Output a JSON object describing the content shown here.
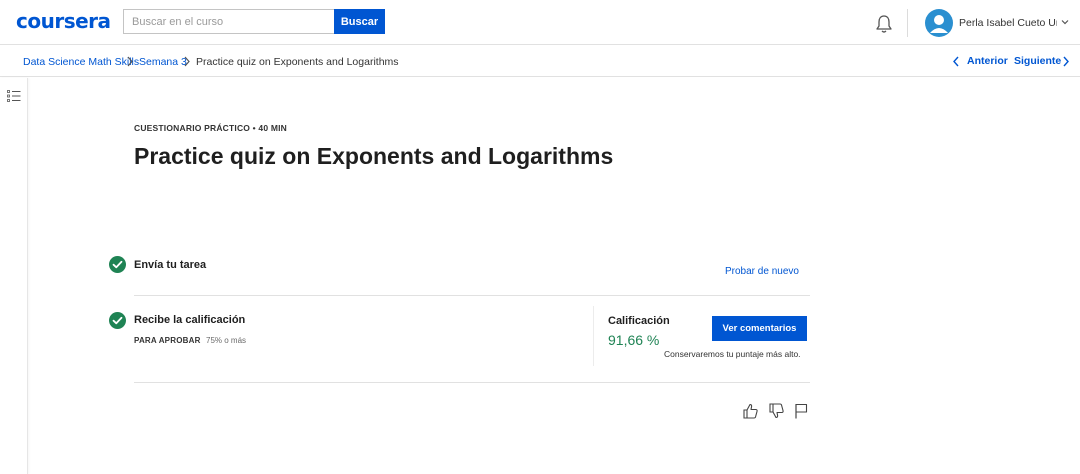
{
  "header": {
    "logo": "coursera",
    "search_placeholder": "Buscar en el curso",
    "search_button": "Buscar",
    "notification_icon": "bell-icon",
    "user_name": "Perla Isabel Cueto Ur...",
    "avatar_icon": "user-avatar-icon",
    "menu_icon": "chevron-down-icon"
  },
  "breadcrumb": {
    "items": [
      "Data Science Math Skills",
      "Semana 3",
      "Practice quiz on Exponents and Logarithms"
    ],
    "prev": "Anterior",
    "next": "Siguiente"
  },
  "sidebar": {
    "toggle_icon": "list-icon"
  },
  "quiz": {
    "kicker": "CUESTIONARIO PRÁCTICO • 40 MIN",
    "title": "Practice quiz on Exponents and Logarithms",
    "step1": {
      "title": "Envía tu tarea",
      "action": "Probar de nuevo",
      "icon": "check-circle-icon"
    },
    "step2": {
      "title": "Recibe la calificación",
      "pass_label": "PARA APROBAR",
      "pass_value": "75% o más",
      "icon": "check-circle-icon"
    },
    "grade": {
      "label": "Calificación",
      "value": "91,66 %",
      "button": "Ver comentarios",
      "note": "Conservaremos tu puntaje más alto."
    },
    "feedback_icons": [
      "thumbs-up-icon",
      "thumbs-down-icon",
      "flag-icon"
    ]
  },
  "colors": {
    "brand": "#0056d2",
    "success": "#1f8354",
    "check": "#1f8354"
  }
}
